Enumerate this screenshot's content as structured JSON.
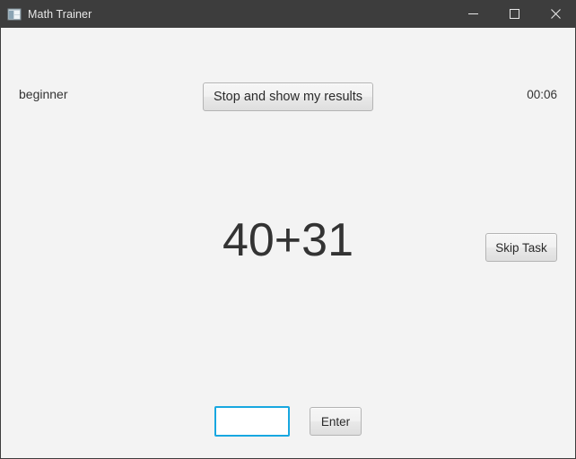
{
  "window": {
    "title": "Math Trainer",
    "app_icon": "app-window-icon",
    "controls": {
      "minimize": "minimize-icon",
      "maximize": "maximize-icon",
      "close": "close-icon"
    },
    "titlebar_color": "#3d3d3d",
    "client_color": "#f3f3f3"
  },
  "session": {
    "level": "beginner",
    "timer": "00:06"
  },
  "toolbar": {
    "stop_label": "Stop and show my results"
  },
  "task": {
    "expression": "40+31",
    "skip_label": "Skip Task"
  },
  "answer": {
    "value": "",
    "placeholder": "",
    "submit_label": "Enter",
    "focus_color": "#18a7e0"
  }
}
